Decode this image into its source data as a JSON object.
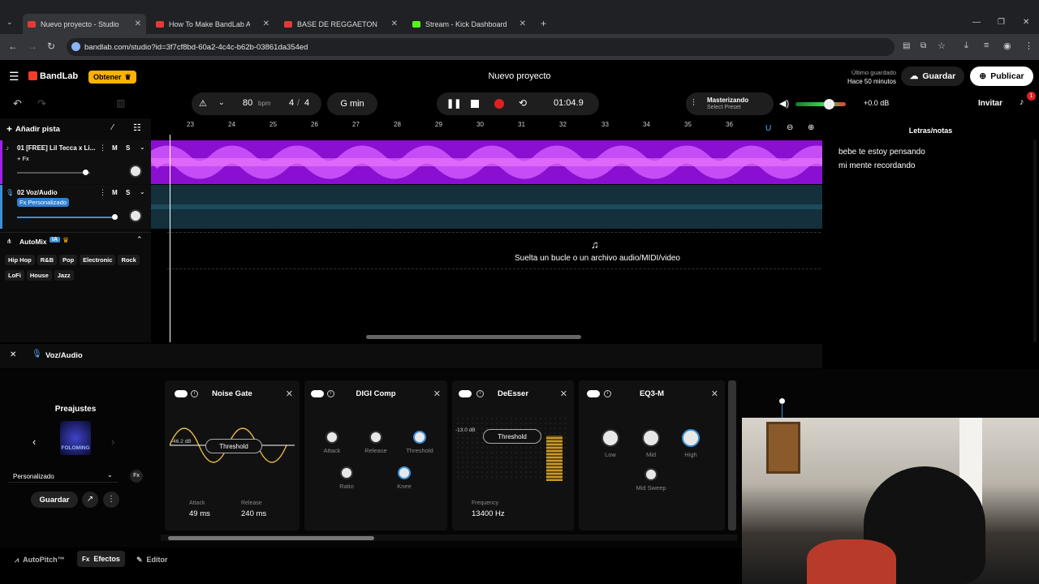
{
  "browser": {
    "tabs": [
      {
        "title": "Nuevo proyecto - Studio",
        "color": "#e53935"
      },
      {
        "title": "How To Make BandLab AutoTun",
        "color": "#e53935"
      },
      {
        "title": "BASE DE REGGAETON USO LIBR",
        "color": "#e53935"
      },
      {
        "title": "Stream - Kick Dashboard",
        "color": "#53fc18"
      }
    ],
    "url": "bandlab.com/studio?id=3f7cf8bd-60a2-4c4c-b62b-03861da354ed"
  },
  "header": {
    "logo": "BandLab",
    "obtener": "Obtener",
    "project_title": "Nuevo proyecto",
    "saved_label": "Último guardado",
    "saved_time": "Hace 50 minutos",
    "save": "Guardar",
    "publish": "Publicar"
  },
  "controls": {
    "bpm": "80",
    "bpm_unit": "bpm",
    "sig_num": "4",
    "sig_slash": "/",
    "sig_den": "4",
    "key": "G min",
    "time": "01:04.9",
    "mastering": "Masterizando",
    "preset": "Select Preset",
    "volume_db": "+0.0 dB",
    "invite": "Invitar",
    "notif_count": "1"
  },
  "tracks": {
    "add": "Añadir pista",
    "ruler": [
      "23",
      "24",
      "25",
      "26",
      "27",
      "28",
      "29",
      "30",
      "31",
      "32",
      "33",
      "34",
      "35",
      "36"
    ],
    "list": [
      {
        "name": "01 [FREE] Lil Tecca x Li...",
        "fx": "+ Fx",
        "m": "M",
        "s": "S"
      },
      {
        "name": "02 Voz/Audio",
        "fx": "Fx Personalizado",
        "m": "M",
        "s": "S"
      }
    ],
    "drop": "Suelta un bucle o un archivo audio/MIDI/video"
  },
  "automix": {
    "title": "AutoMix",
    "ia": "IA",
    "genres_row1": [
      "Hip Hop",
      "R&B",
      "Pop",
      "Electronic",
      "Rock"
    ],
    "genres_row2": [
      "LoFi",
      "House",
      "Jazz"
    ]
  },
  "notes": {
    "title": "Letras/notas",
    "lines": [
      "bebe te estoy pensando",
      "mi mente recordando"
    ]
  },
  "effects": {
    "track": "Voz/Audio",
    "presets_title": "Preajustes",
    "preset_art": "FOLOMING",
    "preset_select": "Personalizado",
    "save": "Guardar",
    "noise_gate": {
      "title": "Noise Gate",
      "db": "-46.2 dB",
      "threshold": "Threshold",
      "attack_label": "Attack",
      "attack": "49 ms",
      "release_label": "Release",
      "release": "240 ms"
    },
    "digi_comp": {
      "title": "DIGI Comp",
      "k1": "Attack",
      "k2": "Release",
      "k3": "Threshold",
      "k4": "Ratio",
      "k5": "Knee"
    },
    "deesser": {
      "title": "DeEsser",
      "db": "-13.0 dB",
      "threshold": "Threshold",
      "freq_label": "Frequency",
      "freq": "13400 Hz"
    },
    "eq": {
      "title": "EQ3-M",
      "k1": "Low",
      "k2": "Mid",
      "k3": "High",
      "k4": "Mid Sweep"
    }
  },
  "bottom": {
    "autopitch": "AutoPitch™",
    "fx": "Fx",
    "efectos": "Efectos",
    "editor": "Editor"
  }
}
